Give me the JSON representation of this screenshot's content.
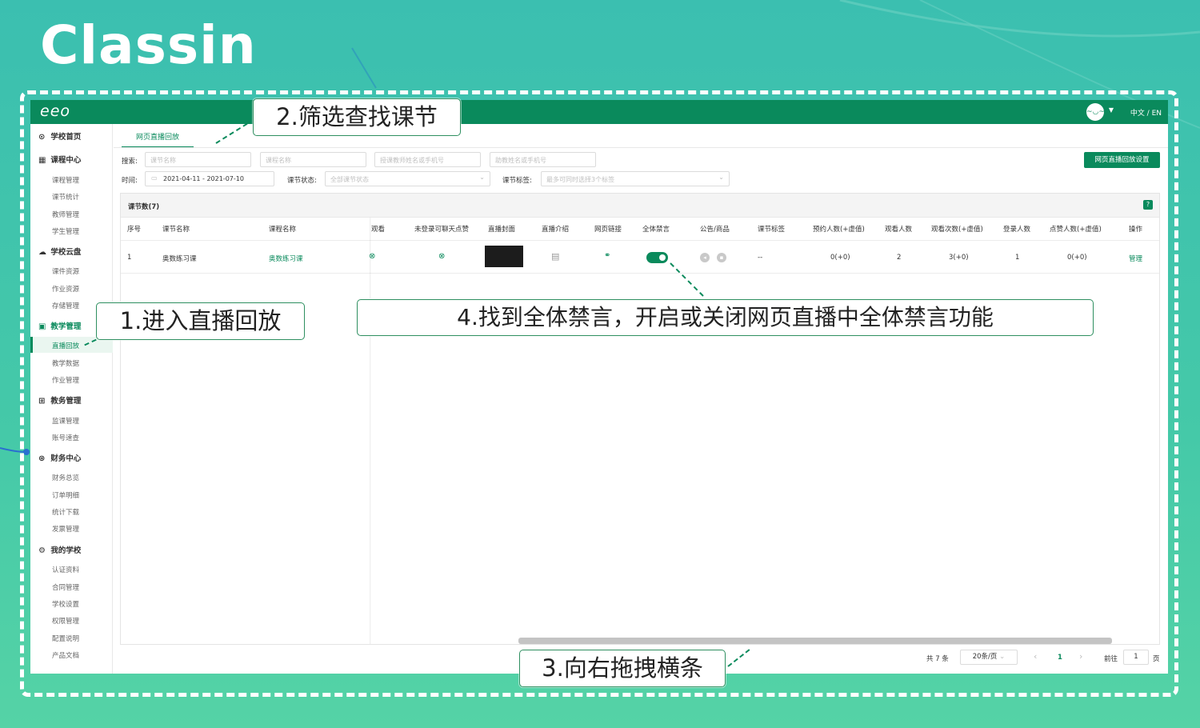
{
  "logo": "Classin",
  "app": {
    "brand": "eeo",
    "avatar": "~◡~",
    "lang": "中文 / EN"
  },
  "sidebar": {
    "groups": [
      {
        "icon": "⊙",
        "label": "学校首页",
        "items": []
      },
      {
        "icon": "▦",
        "label": "课程中心",
        "items": [
          "课程管理",
          "课节统计",
          "教师管理",
          "学生管理"
        ]
      },
      {
        "icon": "☁",
        "label": "学校云盘",
        "items": [
          "课件资源",
          "作业资源",
          "存储管理"
        ]
      },
      {
        "icon": "▣",
        "label": "教学管理",
        "items": [
          "直播回放",
          "教学数据",
          "作业管理"
        ]
      },
      {
        "icon": "⊞",
        "label": "教务管理",
        "items": [
          "监课管理",
          "账号速查"
        ]
      },
      {
        "icon": "⊛",
        "label": "财务中心",
        "items": [
          "财务总览",
          "订单明细",
          "统计下载",
          "发票管理"
        ]
      },
      {
        "icon": "⚙",
        "label": "我的学校",
        "items": [
          "认证资料",
          "合同管理",
          "学校设置",
          "权限管理",
          "配置说明",
          "产品文档"
        ]
      }
    ]
  },
  "tab": "网页直播回放",
  "filters": {
    "search_label": "搜索:",
    "lesson_name_ph": "课节名称",
    "course_name_ph": "课程名称",
    "teacher_ph": "授课教师姓名或手机号",
    "assistant_ph": "助教姓名或手机号",
    "time_label": "时间:",
    "date_range": "2021-04-11  - 2021-07-10",
    "status_label": "课节状态:",
    "status_value": "全部课节状态",
    "tag_label": "课节标签:",
    "tag_ph": "最多可同时选择3个标签",
    "settings_button": "网页直播回放设置"
  },
  "table": {
    "count": "课节数(7)",
    "help": "?",
    "headers": [
      "序号",
      "课节名称",
      "课程名称",
      "观看",
      "未登录可聊天点赞",
      "直播封面",
      "直播介绍",
      "网页链接",
      "全体禁言",
      "公告/商品",
      "课节标签",
      "预约人数(+虚值)",
      "观看人数",
      "观看次数(+虚值)",
      "登录人数",
      "点赞人数(+虚值)",
      "操作"
    ],
    "row": {
      "index": "1",
      "lesson": "奥数练习课",
      "course": "奥数练习课",
      "tag": "--",
      "reserve": "0(+0)",
      "viewers": "2",
      "views": "3(+0)",
      "logins": "1",
      "likes": "0(+0)",
      "action": "管理"
    }
  },
  "pager": {
    "total": "共 7 条",
    "size": "20条/页",
    "prev": "‹",
    "page": "1",
    "next": "›",
    "goto": "前往",
    "goto_value": "1",
    "unit": "页"
  },
  "callouts": {
    "c1": "1.进入直播回放",
    "c2": "2.筛选查找课节",
    "c3": "3.向右拖拽横条",
    "c4": "4.找到全体禁言，开启或关闭网页直播中全体禁言功能"
  },
  "colors": {
    "brand": "#0a8a5c",
    "bg": "#45c9a8"
  }
}
